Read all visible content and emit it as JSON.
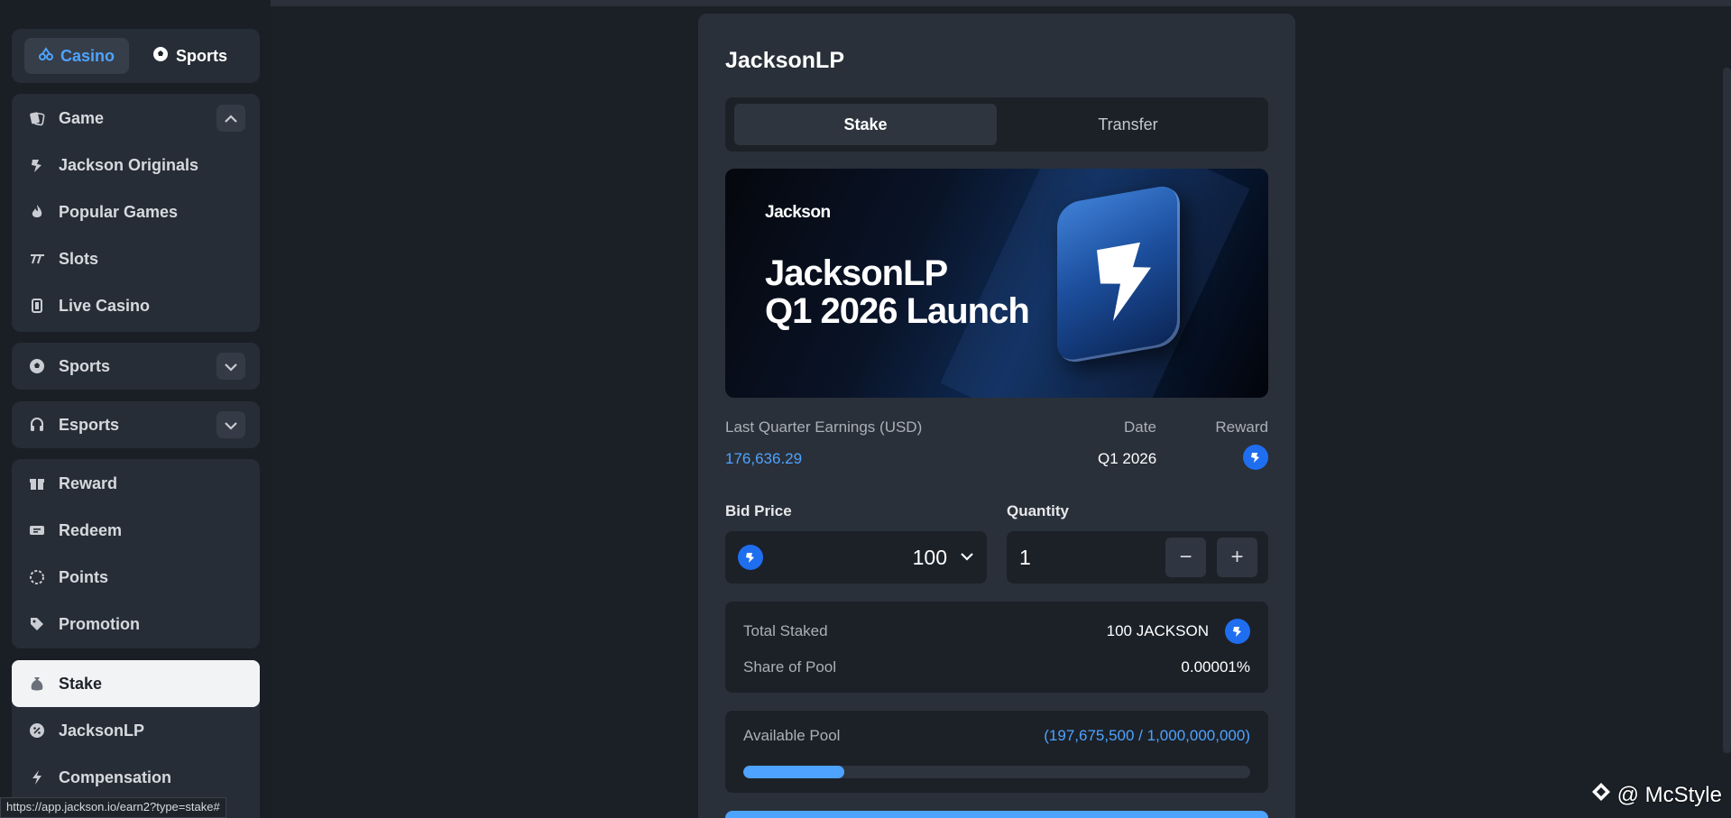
{
  "mode_switch": {
    "casino": "Casino",
    "sports": "Sports"
  },
  "nav_group_game": [
    {
      "label": "Game",
      "icon": "cards-icon"
    },
    {
      "label": "Jackson Originals",
      "icon": "jackson-logo-icon"
    },
    {
      "label": "Popular Games",
      "icon": "flame-icon"
    },
    {
      "label": "Slots",
      "icon": "slots-icon"
    },
    {
      "label": "Live Casino",
      "icon": "dealer-icon"
    }
  ],
  "nav_sports": "Sports",
  "nav_esports": "Esports",
  "nav_group_reward": [
    "Reward",
    "Redeem",
    "Points",
    "Promotion"
  ],
  "nav_group_stake": [
    "Stake",
    "JacksonLP",
    "Compensation"
  ],
  "panel": {
    "title": "JacksonLP",
    "tabs": [
      "Stake",
      "Transfer"
    ],
    "banner": {
      "brand": "Jackson",
      "line1": "JacksonLP",
      "line2": "Q1 2026 Launch"
    },
    "stats": {
      "earnings_label": "Last Quarter Earnings (USD)",
      "date_label": "Date",
      "reward_label": "Reward",
      "earnings_value": "176,636.29",
      "date_value": "Q1 2026"
    },
    "bid": {
      "label": "Bid Price",
      "value": "100"
    },
    "quantity": {
      "label": "Quantity",
      "value": "1",
      "minus": "−",
      "plus": "+"
    },
    "summary": {
      "total_staked_label": "Total Staked",
      "total_staked_value": "100 JACKSON",
      "share_label": "Share of Pool",
      "share_value": "0.00001%"
    },
    "pool": {
      "label": "Available Pool",
      "value": "(197,675,500 / 1,000,000,000)",
      "progress": 0.1977
    }
  },
  "status_url": "https://app.jackson.io/earn2?type=stake#",
  "watermark": "@ McStyle",
  "colors": {
    "accent": "#4ea3ff",
    "coin": "#1f6ef0",
    "background": "#1b2027"
  }
}
